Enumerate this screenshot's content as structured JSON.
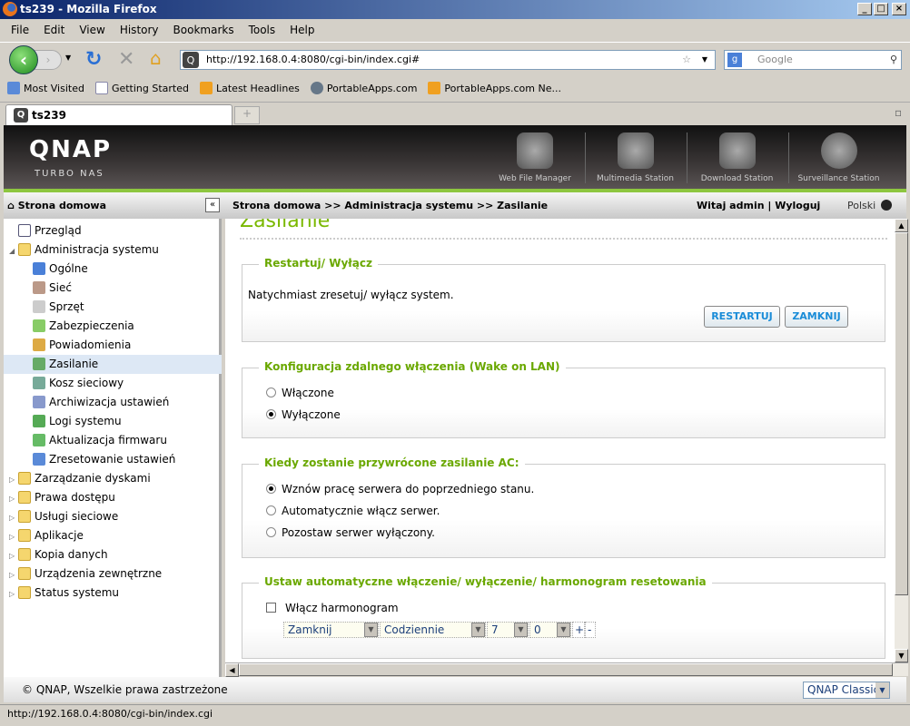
{
  "window": {
    "title": "ts239 - Mozilla Firefox"
  },
  "menu": [
    "File",
    "Edit",
    "View",
    "History",
    "Bookmarks",
    "Tools",
    "Help"
  ],
  "nav": {
    "url": "http://192.168.0.4:8080/cgi-bin/index.cgi#",
    "search_placeholder": "Google"
  },
  "bookmarks": [
    "Most Visited",
    "Getting Started",
    "Latest Headlines",
    "PortableApps.com",
    "PortableApps.com Ne..."
  ],
  "tab": {
    "label": "ts239",
    "new": "+"
  },
  "header": {
    "logo": "QNAP",
    "subtitle": "TURBO NAS",
    "apps": [
      "Web File Manager",
      "Multimedia Station",
      "Download Station",
      "Surveillance Station"
    ]
  },
  "breadcrumb": {
    "home": "Strona domowa",
    "path": "Strona domowa >> Administracja systemu >> Zasilanie",
    "welcome": "Witaj admin | Wyloguj",
    "language": "Polski"
  },
  "sidebar": {
    "items": [
      {
        "label": "Przegląd",
        "level": 0
      },
      {
        "label": "Administracja systemu",
        "level": 0,
        "expanded": true
      },
      {
        "label": "Ogólne",
        "level": 1
      },
      {
        "label": "Sieć",
        "level": 1
      },
      {
        "label": "Sprzęt",
        "level": 1
      },
      {
        "label": "Zabezpieczenia",
        "level": 1
      },
      {
        "label": "Powiadomienia",
        "level": 1
      },
      {
        "label": "Zasilanie",
        "level": 1,
        "selected": true
      },
      {
        "label": "Kosz sieciowy",
        "level": 1
      },
      {
        "label": "Archiwizacja ustawień",
        "level": 1
      },
      {
        "label": "Logi systemu",
        "level": 1
      },
      {
        "label": "Aktualizacja firmwaru",
        "level": 1
      },
      {
        "label": "Zresetowanie ustawień",
        "level": 1
      },
      {
        "label": "Zarządzanie dyskami",
        "level": 0
      },
      {
        "label": "Prawa dostępu",
        "level": 0
      },
      {
        "label": "Usługi sieciowe",
        "level": 0
      },
      {
        "label": "Aplikacje",
        "level": 0
      },
      {
        "label": "Kopia danych",
        "level": 0
      },
      {
        "label": "Urządzenia zewnętrzne",
        "level": 0
      },
      {
        "label": "Status systemu",
        "level": 0
      }
    ]
  },
  "content": {
    "title": "Zasilanie",
    "restart": {
      "legend": "Restartuj/ Wyłącz",
      "text": "Natychmiast zresetuj/ wyłącz system.",
      "restart_btn": "RESTARTUJ",
      "shutdown_btn": "ZAMKNIJ"
    },
    "wol": {
      "legend": "Konfiguracja zdalnego włączenia (Wake on LAN)",
      "options": [
        "Włączone",
        "Wyłączone"
      ],
      "selected": 1
    },
    "ac": {
      "legend": "Kiedy zostanie przywrócone zasilanie AC:",
      "options": [
        "Wznów pracę serwera do poprzedniego stanu.",
        "Automatycznie włącz serwer.",
        "Pozostaw serwer wyłączony."
      ],
      "selected": 0
    },
    "schedule": {
      "legend": "Ustaw automatyczne włączenie/ wyłączenie/ harmonogram resetowania",
      "checkbox": "Włącz harmonogram",
      "checked": false,
      "action": "Zamknij",
      "frequency": "Codziennie",
      "hour": "7",
      "minute": "0",
      "add": "+",
      "remove": "-"
    }
  },
  "footer": {
    "copyright": "© QNAP, Wszelkie prawa zastrzeżone",
    "theme": "QNAP Classic"
  },
  "status": "http://192.168.0.4:8080/cgi-bin/index.cgi"
}
